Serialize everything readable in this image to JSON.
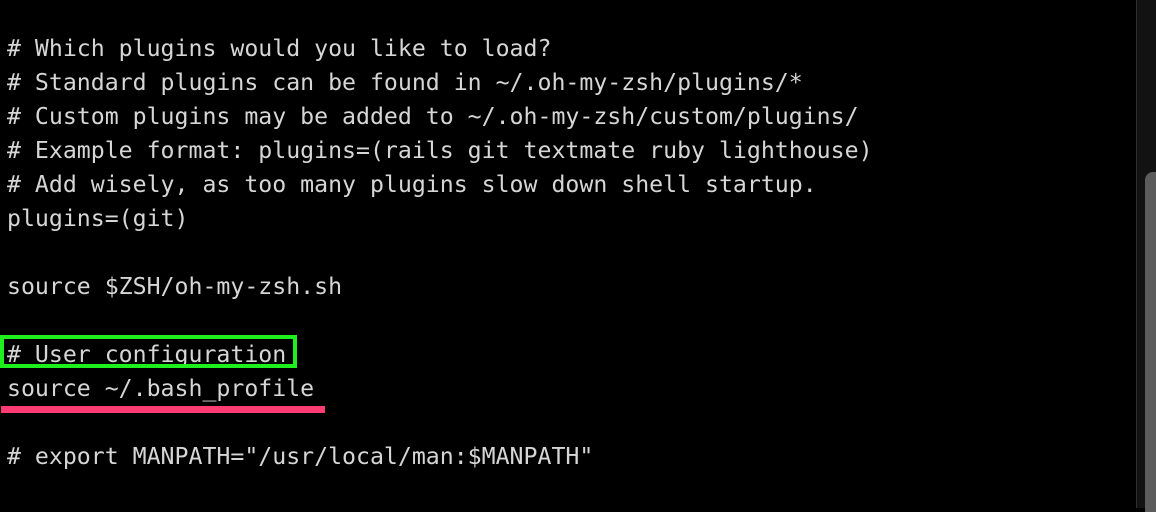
{
  "editor": {
    "lines": [
      "# Which plugins would you like to load?",
      "# Standard plugins can be found in ~/.oh-my-zsh/plugins/*",
      "# Custom plugins may be added to ~/.oh-my-zsh/custom/plugins/",
      "# Example format: plugins=(rails git textmate ruby lighthouse)",
      "# Add wisely, as too many plugins slow down shell startup.",
      "plugins=(git)",
      "",
      "source $ZSH/oh-my-zsh.sh",
      "",
      "# User configuration",
      "source ~/.bash_profile",
      "",
      "# export MANPATH=\"/usr/local/man:$MANPATH\""
    ]
  },
  "annotations": {
    "box_color": "#1df01d",
    "box_target": "# User configuration",
    "underline_color": "#ff3b74",
    "underline_target": "source ~/.bash_profile"
  },
  "colors": {
    "background": "#000000",
    "text": "#d6d6d6"
  }
}
